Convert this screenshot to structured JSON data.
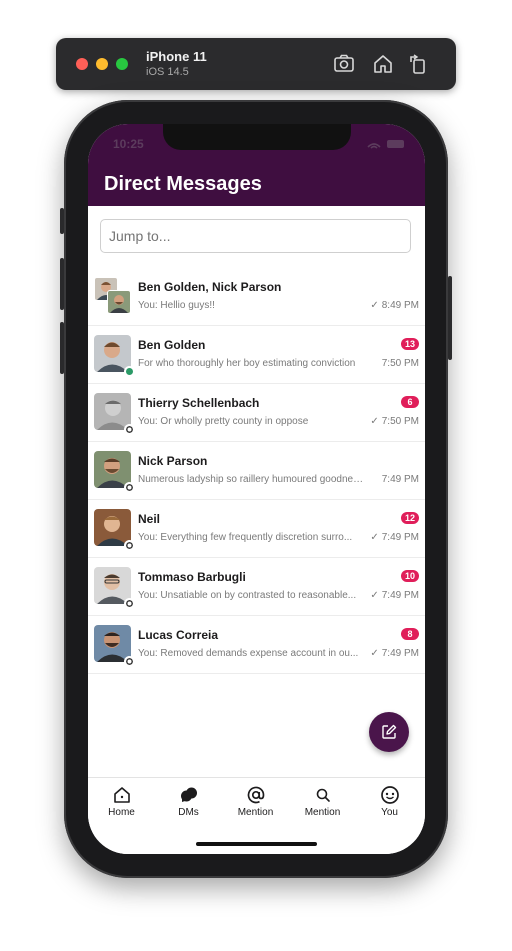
{
  "simulator": {
    "device": "iPhone 11",
    "os": "iOS 14.5"
  },
  "status_bar": {
    "time": "10:25"
  },
  "header": {
    "title": "Direct Messages"
  },
  "search": {
    "placeholder": "Jump to..."
  },
  "conversations": [
    {
      "name": "Ben Golden, Nick Parson",
      "preview": "You: Hellio guys!!",
      "time": "8:49 PM",
      "sent": true,
      "unread": null,
      "presence": null
    },
    {
      "name": "Ben Golden",
      "preview": "For who thoroughly her boy estimating conviction",
      "time": "7:50 PM",
      "sent": false,
      "unread": "13",
      "presence": "online"
    },
    {
      "name": "Thierry Schellenbach",
      "preview": "You: Or wholly pretty county in oppose",
      "time": "7:50 PM",
      "sent": true,
      "unread": "6",
      "presence": "offline"
    },
    {
      "name": "Nick Parson",
      "preview": "Numerous ladyship so raillery humoured goodness...",
      "time": "7:49 PM",
      "sent": false,
      "unread": null,
      "presence": "offline"
    },
    {
      "name": "Neil",
      "preview": "You: Everything few frequently discretion surro...",
      "time": "7:49 PM",
      "sent": true,
      "unread": "12",
      "presence": "offline"
    },
    {
      "name": "Tommaso Barbugli",
      "preview": "You: Unsatiable on by contrasted to reasonable...",
      "time": "7:49 PM",
      "sent": true,
      "unread": "10",
      "presence": "offline"
    },
    {
      "name": "Lucas Correia",
      "preview": "You: Removed demands expense account in ou...",
      "time": "7:49 PM",
      "sent": true,
      "unread": "8",
      "presence": "offline"
    }
  ],
  "check_mark": "✓",
  "tabs": [
    {
      "label": "Home",
      "icon": "home-icon"
    },
    {
      "label": "DMs",
      "icon": "dms-icon"
    },
    {
      "label": "Mention",
      "icon": "at-icon"
    },
    {
      "label": "Mention",
      "icon": "search-icon"
    },
    {
      "label": "You",
      "icon": "smile-icon"
    }
  ],
  "colors": {
    "header": "#3f0e40",
    "fab": "#4a154b",
    "badge": "#e01e5a",
    "online": "#2b9a67"
  }
}
